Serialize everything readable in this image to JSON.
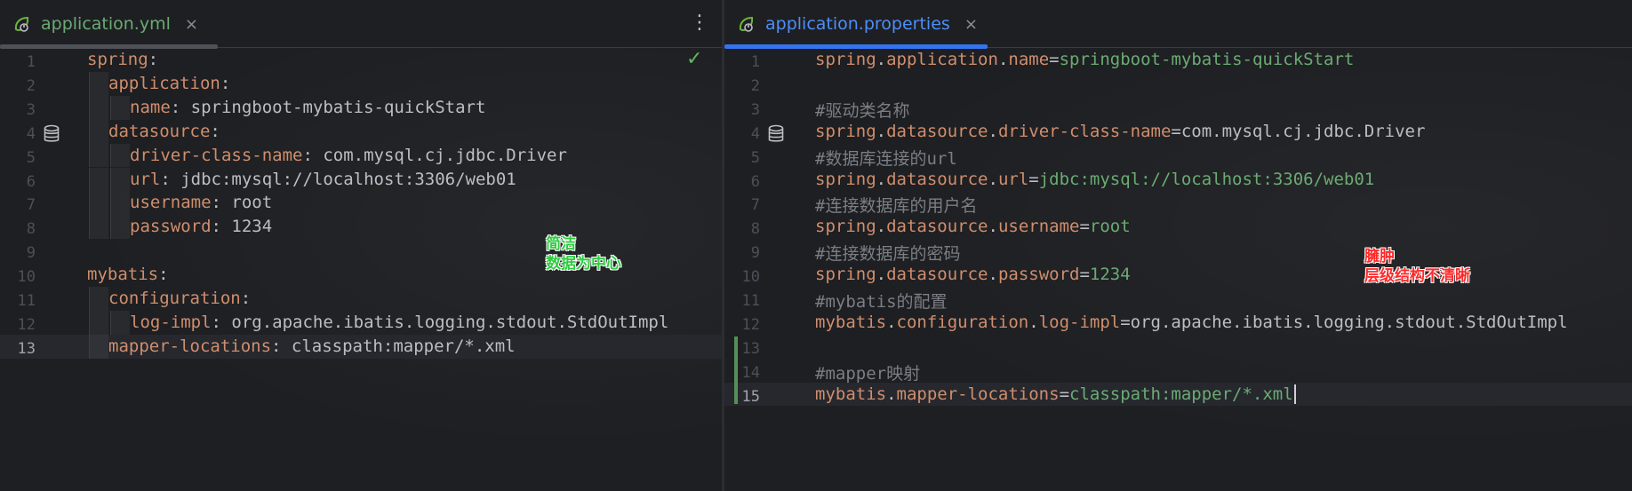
{
  "left_tab": {
    "title": "application.yml",
    "close": "×",
    "icon": "spring-leaf-icon",
    "underline_color": "#4e5157"
  },
  "right_tab": {
    "title": "application.properties",
    "close": "×",
    "icon": "spring-leaf-icon",
    "underline_color": "#3574f0"
  },
  "menu": {
    "icon": "more-vertical-icon",
    "glyph": "⋮"
  },
  "status": {
    "icon": "check-icon",
    "glyph": "✓",
    "color": "#5fb865"
  },
  "yaml_lines": [
    {
      "n": "1",
      "indent": 0,
      "key": "spring",
      "sep": ":",
      "value": ""
    },
    {
      "n": "2",
      "indent": 1,
      "key": "application",
      "sep": ":",
      "value": ""
    },
    {
      "n": "3",
      "indent": 2,
      "key": "name",
      "sep": ":",
      "value": " springboot-mybatis-quickStart"
    },
    {
      "n": "4",
      "indent": 1,
      "key": "datasource",
      "sep": ":",
      "value": ""
    },
    {
      "n": "5",
      "indent": 2,
      "key": "driver-class-name",
      "sep": ":",
      "value": " com.mysql.cj.jdbc.Driver"
    },
    {
      "n": "6",
      "indent": 2,
      "key": "url",
      "sep": ":",
      "value": " jdbc:mysql://localhost:3306/web01"
    },
    {
      "n": "7",
      "indent": 2,
      "key": "username",
      "sep": ":",
      "value": " root"
    },
    {
      "n": "8",
      "indent": 2,
      "key": "password",
      "sep": ":",
      "value": " 1234"
    },
    {
      "n": "9",
      "indent": 0,
      "key": "",
      "sep": "",
      "value": ""
    },
    {
      "n": "10",
      "indent": 0,
      "key": "mybatis",
      "sep": ":",
      "value": ""
    },
    {
      "n": "11",
      "indent": 1,
      "key": "configuration",
      "sep": ":",
      "value": ""
    },
    {
      "n": "12",
      "indent": 2,
      "key": "log-impl",
      "sep": ":",
      "value": " org.apache.ibatis.logging.stdout.StdOutImpl"
    },
    {
      "n": "13",
      "indent": 1,
      "key": "mapper-locations",
      "sep": ":",
      "value": " classpath:mapper/*.xml"
    }
  ],
  "props_lines": [
    {
      "n": "1",
      "kind": "prop",
      "key": [
        "spring",
        ".",
        "application",
        ".",
        "name"
      ],
      "eq": "=",
      "value": "springboot-mybatis-quickStart"
    },
    {
      "n": "2",
      "kind": "blank"
    },
    {
      "n": "3",
      "kind": "comment",
      "text": "#驱动类名称"
    },
    {
      "n": "4",
      "kind": "prop",
      "key": [
        "spring",
        ".",
        "datasource",
        ".",
        "driver-class-name"
      ],
      "eq": "=",
      "value": "com.mysql.cj.jdbc.Driver",
      "value_plain": true
    },
    {
      "n": "5",
      "kind": "comment",
      "text": "#数据库连接的url"
    },
    {
      "n": "6",
      "kind": "prop",
      "key": [
        "spring",
        ".",
        "datasource",
        ".",
        "url"
      ],
      "eq": "=",
      "value": "jdbc:mysql://localhost:3306/web01"
    },
    {
      "n": "7",
      "kind": "comment",
      "text": "#连接数据库的用户名"
    },
    {
      "n": "8",
      "kind": "prop",
      "key": [
        "spring",
        ".",
        "datasource",
        ".",
        "username"
      ],
      "eq": "=",
      "value": "root"
    },
    {
      "n": "9",
      "kind": "comment",
      "text": "#连接数据库的密码"
    },
    {
      "n": "10",
      "kind": "prop",
      "key": [
        "spring",
        ".",
        "datasource",
        ".",
        "password"
      ],
      "eq": "=",
      "value": "1234"
    },
    {
      "n": "11",
      "kind": "comment",
      "text": "#mybatis的配置"
    },
    {
      "n": "12",
      "kind": "prop",
      "key": [
        "mybatis",
        ".",
        "configuration",
        ".",
        "log-impl"
      ],
      "eq": "=",
      "value": "org.apache.ibatis.logging.stdout.StdOutImpl",
      "value_plain": true
    },
    {
      "n": "13",
      "kind": "blank"
    },
    {
      "n": "14",
      "kind": "comment",
      "text": "#mapper映射"
    },
    {
      "n": "15",
      "kind": "prop",
      "key": [
        "mybatis",
        ".",
        "mapper-locations"
      ],
      "eq": "=",
      "value": "classpath:mapper/*.xml",
      "caret": true
    }
  ],
  "annotations": {
    "green": "简洁\n数据为中心",
    "red": "臃肿\n层级结构不清晰"
  },
  "colors": {
    "key": "#cf8e6d",
    "string": "#6aab73",
    "text": "#bcbec4",
    "comment": "#7a7e85",
    "accent": "#3574f0"
  }
}
